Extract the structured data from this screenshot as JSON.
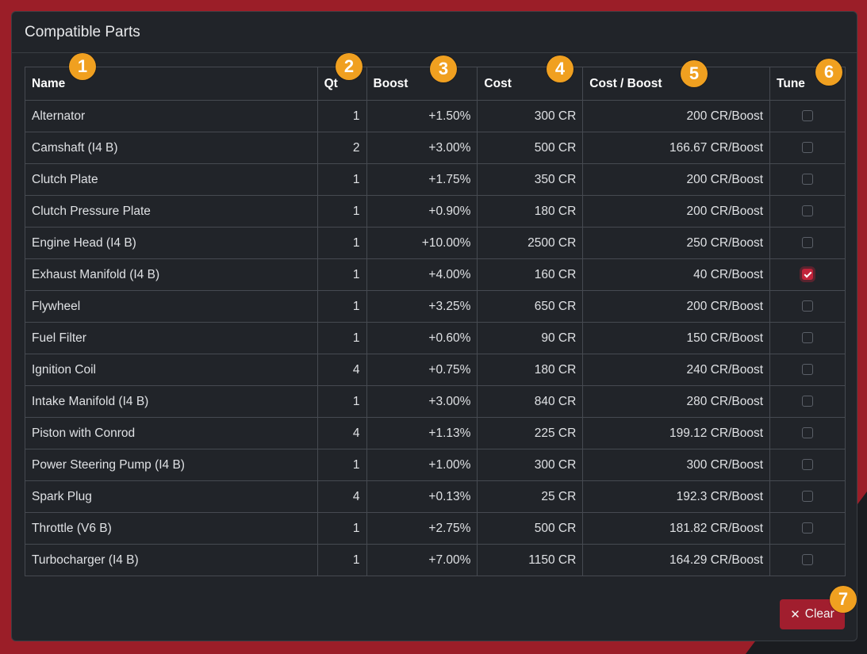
{
  "panel": {
    "title": "Compatible Parts"
  },
  "table": {
    "headers": {
      "name": "Name",
      "qt": "Qt",
      "boost": "Boost",
      "cost": "Cost",
      "cost_boost": "Cost / Boost",
      "tune": "Tune"
    },
    "rows": [
      {
        "name": "Alternator",
        "qt": "1",
        "boost": "+1.50%",
        "cost": "300 CR",
        "cost_boost": "200 CR/Boost",
        "tune": false
      },
      {
        "name": "Camshaft (I4 B)",
        "qt": "2",
        "boost": "+3.00%",
        "cost": "500 CR",
        "cost_boost": "166.67 CR/Boost",
        "tune": false
      },
      {
        "name": "Clutch Plate",
        "qt": "1",
        "boost": "+1.75%",
        "cost": "350 CR",
        "cost_boost": "200 CR/Boost",
        "tune": false
      },
      {
        "name": "Clutch Pressure Plate",
        "qt": "1",
        "boost": "+0.90%",
        "cost": "180 CR",
        "cost_boost": "200 CR/Boost",
        "tune": false
      },
      {
        "name": "Engine Head (I4 B)",
        "qt": "1",
        "boost": "+10.00%",
        "cost": "2500 CR",
        "cost_boost": "250 CR/Boost",
        "tune": false
      },
      {
        "name": "Exhaust Manifold (I4 B)",
        "qt": "1",
        "boost": "+4.00%",
        "cost": "160 CR",
        "cost_boost": "40 CR/Boost",
        "tune": true
      },
      {
        "name": "Flywheel",
        "qt": "1",
        "boost": "+3.25%",
        "cost": "650 CR",
        "cost_boost": "200 CR/Boost",
        "tune": false
      },
      {
        "name": "Fuel Filter",
        "qt": "1",
        "boost": "+0.60%",
        "cost": "90 CR",
        "cost_boost": "150 CR/Boost",
        "tune": false
      },
      {
        "name": "Ignition Coil",
        "qt": "4",
        "boost": "+0.75%",
        "cost": "180 CR",
        "cost_boost": "240 CR/Boost",
        "tune": false
      },
      {
        "name": "Intake Manifold (I4 B)",
        "qt": "1",
        "boost": "+3.00%",
        "cost": "840 CR",
        "cost_boost": "280 CR/Boost",
        "tune": false
      },
      {
        "name": "Piston with Conrod",
        "qt": "4",
        "boost": "+1.13%",
        "cost": "225 CR",
        "cost_boost": "199.12 CR/Boost",
        "tune": false
      },
      {
        "name": "Power Steering Pump (I4 B)",
        "qt": "1",
        "boost": "+1.00%",
        "cost": "300 CR",
        "cost_boost": "300 CR/Boost",
        "tune": false
      },
      {
        "name": "Spark Plug",
        "qt": "4",
        "boost": "+0.13%",
        "cost": "25 CR",
        "cost_boost": "192.3 CR/Boost",
        "tune": false
      },
      {
        "name": "Throttle (V6 B)",
        "qt": "1",
        "boost": "+2.75%",
        "cost": "500 CR",
        "cost_boost": "181.82 CR/Boost",
        "tune": false
      },
      {
        "name": "Turbocharger (I4 B)",
        "qt": "1",
        "boost": "+7.00%",
        "cost": "1150 CR",
        "cost_boost": "164.29 CR/Boost",
        "tune": false
      }
    ]
  },
  "clear_button": {
    "label": "Clear",
    "icon": "close-icon"
  },
  "badges": [
    "1",
    "2",
    "3",
    "4",
    "5",
    "6",
    "7"
  ],
  "colors": {
    "background": "#9b1e28",
    "panel": "#212429",
    "accent": "#c2233a",
    "badge": "#f0a020"
  }
}
